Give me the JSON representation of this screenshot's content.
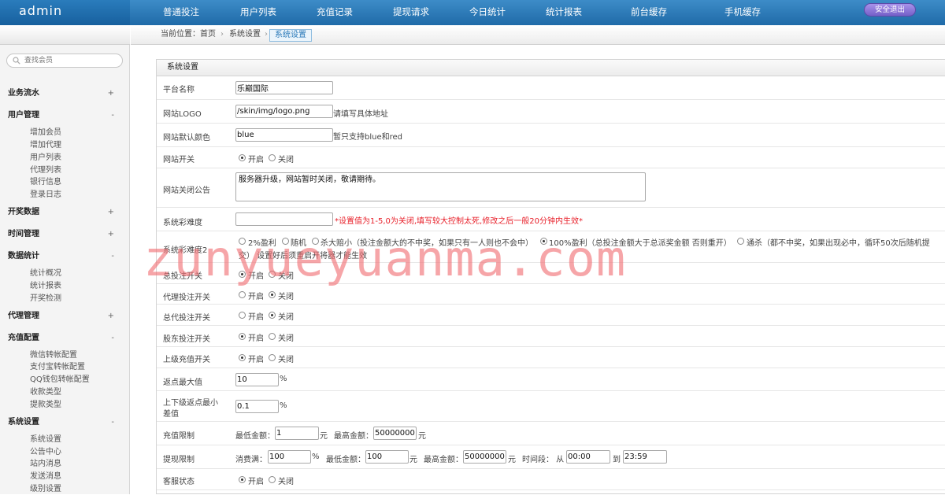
{
  "brand": "admin",
  "nav": [
    "普通投注",
    "用户列表",
    "充值记录",
    "提现请求",
    "今日统计",
    "统计报表",
    "前台缓存",
    "手机缓存"
  ],
  "logout_label": "安全退出",
  "search": {
    "placeholder": "查找会员"
  },
  "sidebar": {
    "groups": [
      {
        "label": "业务流水",
        "sign": "+"
      },
      {
        "label": "用户管理",
        "sign": "-",
        "items": [
          "增加会员",
          "增加代理",
          "用户列表",
          "代理列表",
          "银行信息",
          "登录日志"
        ]
      },
      {
        "label": "开奖数据",
        "sign": "+"
      },
      {
        "label": "时间管理",
        "sign": "+"
      },
      {
        "label": "数据统计",
        "sign": "-",
        "items": [
          "统计概况",
          "统计报表",
          "开奖检测"
        ]
      },
      {
        "label": "代理管理",
        "sign": "+"
      },
      {
        "label": "充值配置",
        "sign": "-",
        "items": [
          "微信转帐配置",
          "支付宝转帐配置",
          "QQ钱包转帐配置",
          "收款类型",
          "提款类型"
        ]
      },
      {
        "label": "系统设置",
        "sign": "-",
        "items": [
          "系统设置",
          "公告中心",
          "站内消息",
          "发送消息",
          "级别设置"
        ]
      }
    ]
  },
  "breadcrumb": {
    "prefix": "当前位置：首页",
    "items": [
      "系统设置",
      "系统设置"
    ]
  },
  "panel": {
    "title": "系统设置"
  },
  "form": {
    "platform_name": {
      "label": "平台名称",
      "value": "乐巅国际"
    },
    "logo": {
      "label": "网站LOGO",
      "value": "/skin/img/logo.png",
      "hint": "请填写具体地址"
    },
    "color": {
      "label": "网站默认颜色",
      "value": "blue",
      "hint": "暂只支持blue和red"
    },
    "site_switch": {
      "label": "网站开关",
      "on": "开启",
      "off": "关闭",
      "selected": "on"
    },
    "close_notice": {
      "label": "网站关闭公告",
      "value": "服务器升级，网站暂时关闭，敬请期待。"
    },
    "difficulty": {
      "label": "系统彩难度",
      "value": "",
      "warning": "*设置值为1-5,0为关闭,填写较大控制太死,修改之后一般20分钟内生效*"
    },
    "difficulty2": {
      "label": "系统彩难度2",
      "options": [
        "2%盈利",
        "随机",
        "杀大赔小（投注金额大的不中奖，如果只有一人则也不会中）",
        "100%盈利（总投注金额大于总派奖金额 否则重开）",
        "通杀（都不中奖，如果出现必中，循环50次后随机提"
      ],
      "line2": "交）    设置好后须重启开将器才能生效",
      "selected": 3
    },
    "total_bet": {
      "label": "总投注开关",
      "on": "开启",
      "off": "关闭",
      "selected": "on"
    },
    "agent_bet": {
      "label": "代理投注开关",
      "on": "开启",
      "off": "关闭",
      "selected": "off"
    },
    "general_agent_bet": {
      "label": "总代投注开关",
      "on": "开启",
      "off": "关闭",
      "selected": "off"
    },
    "shareholder_bet": {
      "label": "股东投注开关",
      "on": "开启",
      "off": "关闭",
      "selected": "on"
    },
    "upper_recharge": {
      "label": "上级充值开关",
      "on": "开启",
      "off": "关闭",
      "selected": "on"
    },
    "rebate_max": {
      "label": "返点最大值",
      "value": "10",
      "unit": "%"
    },
    "rebate_diff": {
      "label1": "上下级返点最小",
      "label2": "差值",
      "value": "0.1",
      "unit": "%"
    },
    "recharge_limit": {
      "label": "充值限制",
      "min_label": "最低金额：",
      "min": "1",
      "unit": "元",
      "max_label": "最高金额：",
      "max": "50000000"
    },
    "withdraw_limit": {
      "label": "提现限制",
      "consume_label": "消费满：",
      "consume": "100",
      "pct": "%",
      "min_label": "最低金额：",
      "min": "100",
      "unit": "元",
      "max_label": "最高金额：",
      "max": "50000000",
      "time_label": "时间段： 从",
      "from": "00:00",
      "to_label": "到",
      "to": "23:59"
    },
    "service": {
      "label": "客服状态",
      "on": "开启",
      "off": "关闭",
      "selected": "on"
    }
  },
  "watermark": "zunyueyuanma.com"
}
